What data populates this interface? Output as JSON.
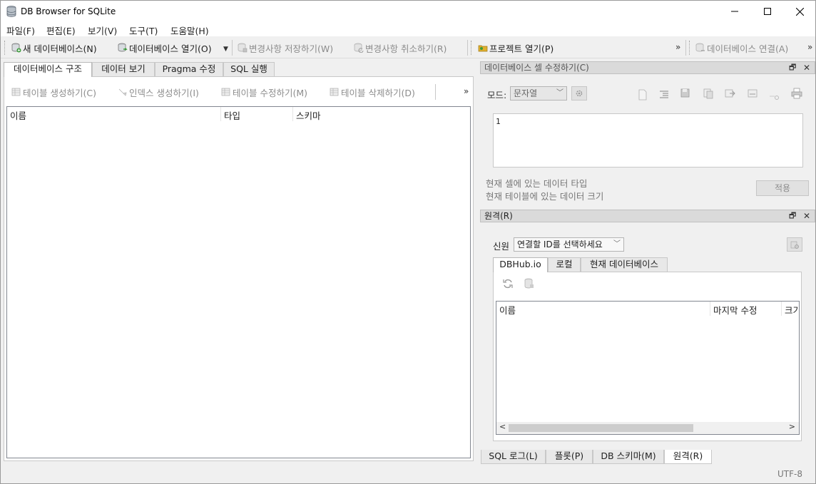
{
  "window": {
    "title": "DB Browser for SQLite"
  },
  "menu": [
    "파일(F)",
    "편집(E)",
    "보기(V)",
    "도구(T)",
    "도움말(H)"
  ],
  "toolbar": {
    "new_db": "새 데이터베이스(N)",
    "open_db": "데이터베이스 열기(O)",
    "write_changes": "변경사항 저장하기(W)",
    "revert_changes": "변경사항 취소하기(R)",
    "open_project": "프로젝트 열기(P)",
    "attach_db": "데이터베이스 연결(A)",
    "overflow": "»"
  },
  "main_tabs": [
    "데이터베이스 구조",
    "데이터 보기",
    "Pragma 수정",
    "SQL 실행"
  ],
  "structure_toolbar": {
    "create_table": "테이블 생성하기(C)",
    "create_index": "인덱스 생성하기(I)",
    "modify_table": "테이블 수정하기(M)",
    "delete_table": "테이블 삭제하기(D)",
    "overflow": "»"
  },
  "schema_columns": [
    "이름",
    "타입",
    "스키마"
  ],
  "edit_cell": {
    "title": "데이터베이스 셀 수정하기(C)",
    "mode_label": "모드:",
    "mode_value": "문자열",
    "content": "1",
    "type_info": "현재 셀에 있는 데이터 타입",
    "size_info": "현재 테이블에 있는 데이터 크기",
    "apply_label": "적용"
  },
  "remote": {
    "title": "원격(R)",
    "identity_label": "신원",
    "identity_value": "연결할 ID를 선택하세요",
    "tabs": [
      "DBHub.io",
      "로컬",
      "현재 데이터베이스"
    ],
    "columns": [
      "이름",
      "마지막 수정",
      "크기"
    ]
  },
  "bottom_tabs": [
    "SQL 로그(L)",
    "플롯(P)",
    "DB 스키마(M)",
    "원격(R)"
  ],
  "status": {
    "encoding": "UTF-8"
  },
  "colors": {
    "accent_green": "#3a9a3a",
    "icon_gray": "#9a9a9a",
    "folder_yellow": "#e0b030"
  }
}
